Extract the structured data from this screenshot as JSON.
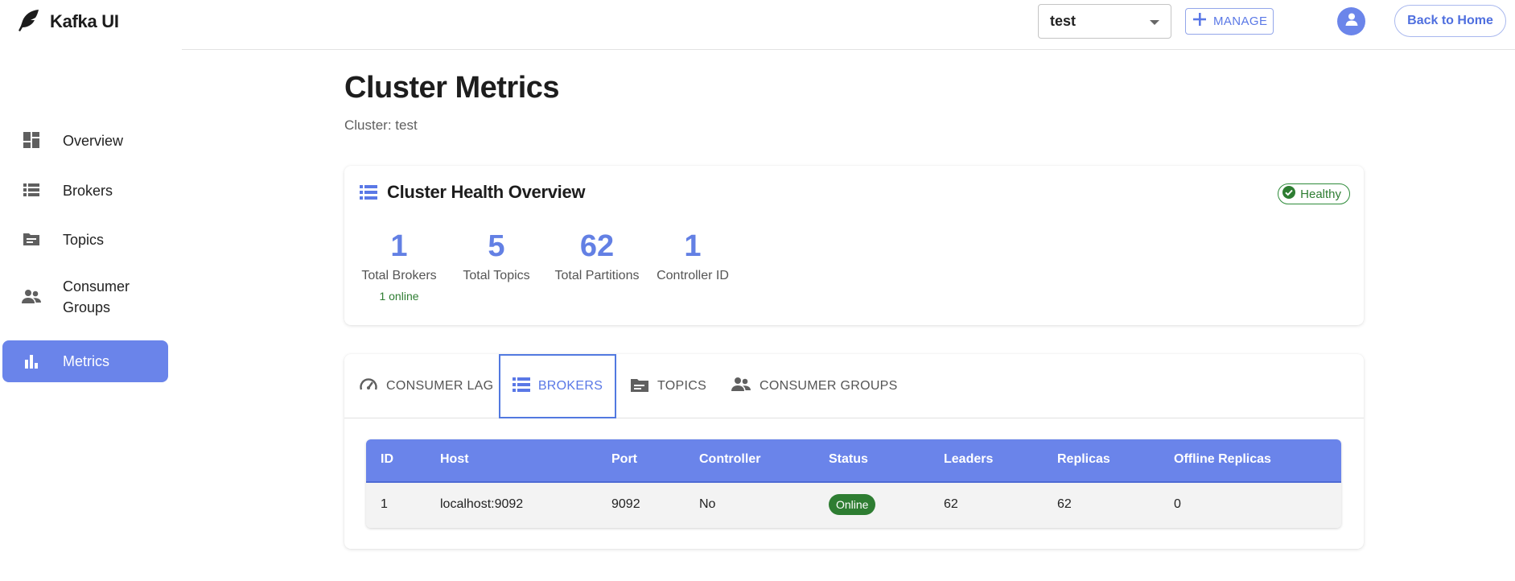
{
  "app": {
    "title": "Kafka UI"
  },
  "header": {
    "cluster_select_value": "test",
    "manage_label": "MANAGE",
    "back_label": "Back to Home"
  },
  "sidebar": {
    "items": [
      {
        "label": "Overview",
        "icon": "dashboard-icon",
        "active": false
      },
      {
        "label": "Brokers",
        "icon": "list-icon",
        "active": false
      },
      {
        "label": "Topics",
        "icon": "folder-icon",
        "active": false
      },
      {
        "label": "Consumer Groups",
        "icon": "people-icon",
        "active": false
      },
      {
        "label": "Metrics",
        "icon": "bar-chart-icon",
        "active": true
      }
    ]
  },
  "page": {
    "title": "Cluster Metrics",
    "subtitle": "Cluster: test"
  },
  "health": {
    "title": "Cluster Health Overview",
    "status": "Healthy",
    "stats": [
      {
        "value": "1",
        "label": "Total Brokers",
        "extra": "1 online"
      },
      {
        "value": "5",
        "label": "Total Topics"
      },
      {
        "value": "62",
        "label": "Total Partitions"
      },
      {
        "value": "1",
        "label": "Controller ID"
      }
    ]
  },
  "tabs": [
    {
      "label": "CONSUMER LAG",
      "icon": "speedometer-icon",
      "active": false
    },
    {
      "label": "BROKERS",
      "icon": "list-icon",
      "active": true
    },
    {
      "label": "TOPICS",
      "icon": "folder-icon",
      "active": false
    },
    {
      "label": "CONSUMER GROUPS",
      "icon": "people-icon",
      "active": false
    }
  ],
  "brokers_table": {
    "columns": [
      "ID",
      "Host",
      "Port",
      "Controller",
      "Status",
      "Leaders",
      "Replicas",
      "Offline Replicas"
    ],
    "rows": [
      {
        "id": "1",
        "host": "localhost:9092",
        "port": "9092",
        "controller": "No",
        "status": "Online",
        "leaders": "62",
        "replicas": "62",
        "offline_replicas": "0"
      }
    ]
  },
  "colors": {
    "accent": "#6a84ea",
    "stat_value": "#6380e4",
    "healthy": "#2e7d32"
  }
}
